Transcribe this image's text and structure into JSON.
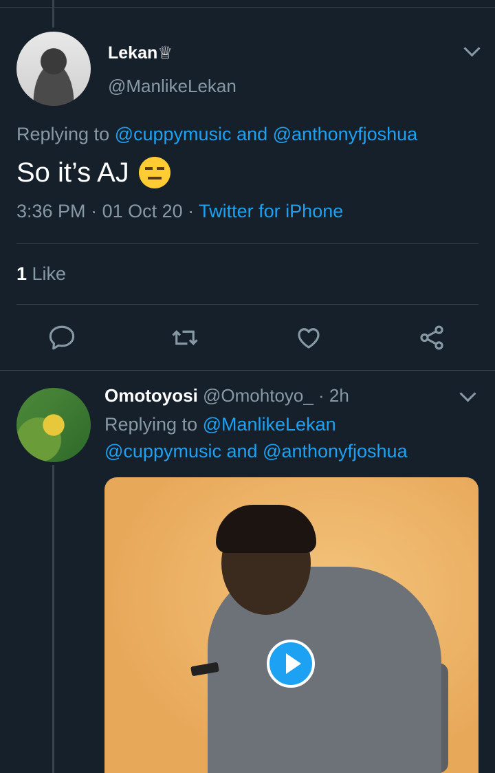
{
  "main_tweet": {
    "name": "Lekan♕",
    "handle": "@ManlikeLekan",
    "replying_prefix": "Replying to ",
    "reply_to_1": "@cuppymusic",
    "reply_and": " and ",
    "reply_to_2": "@anthonyfjoshua",
    "text": "So it’s AJ",
    "emoji": "expressionless-face-emoji",
    "time": "3:36 PM",
    "sep": " · ",
    "date": "01 Oct 20",
    "source": "Twitter for iPhone",
    "like_count": "1",
    "like_label": " Like"
  },
  "reply_tweet": {
    "name": "Omotoyosi",
    "handle": " @Omohtoyo_",
    "time": " · 2h",
    "replying_prefix": "Replying to ",
    "reply_to_1": "@ManlikeLekan",
    "reply_to_2": "@cuppymusic",
    "reply_and": " and ",
    "reply_to_3": "@anthonyfjoshua"
  },
  "colors": {
    "background": "#15202b",
    "accent": "#1da1f2",
    "secondary_text": "#8899a6",
    "divider": "#38444d"
  },
  "icons": [
    "chevron-down-icon",
    "reply-icon",
    "retweet-icon",
    "like-icon",
    "share-icon",
    "play-icon"
  ]
}
